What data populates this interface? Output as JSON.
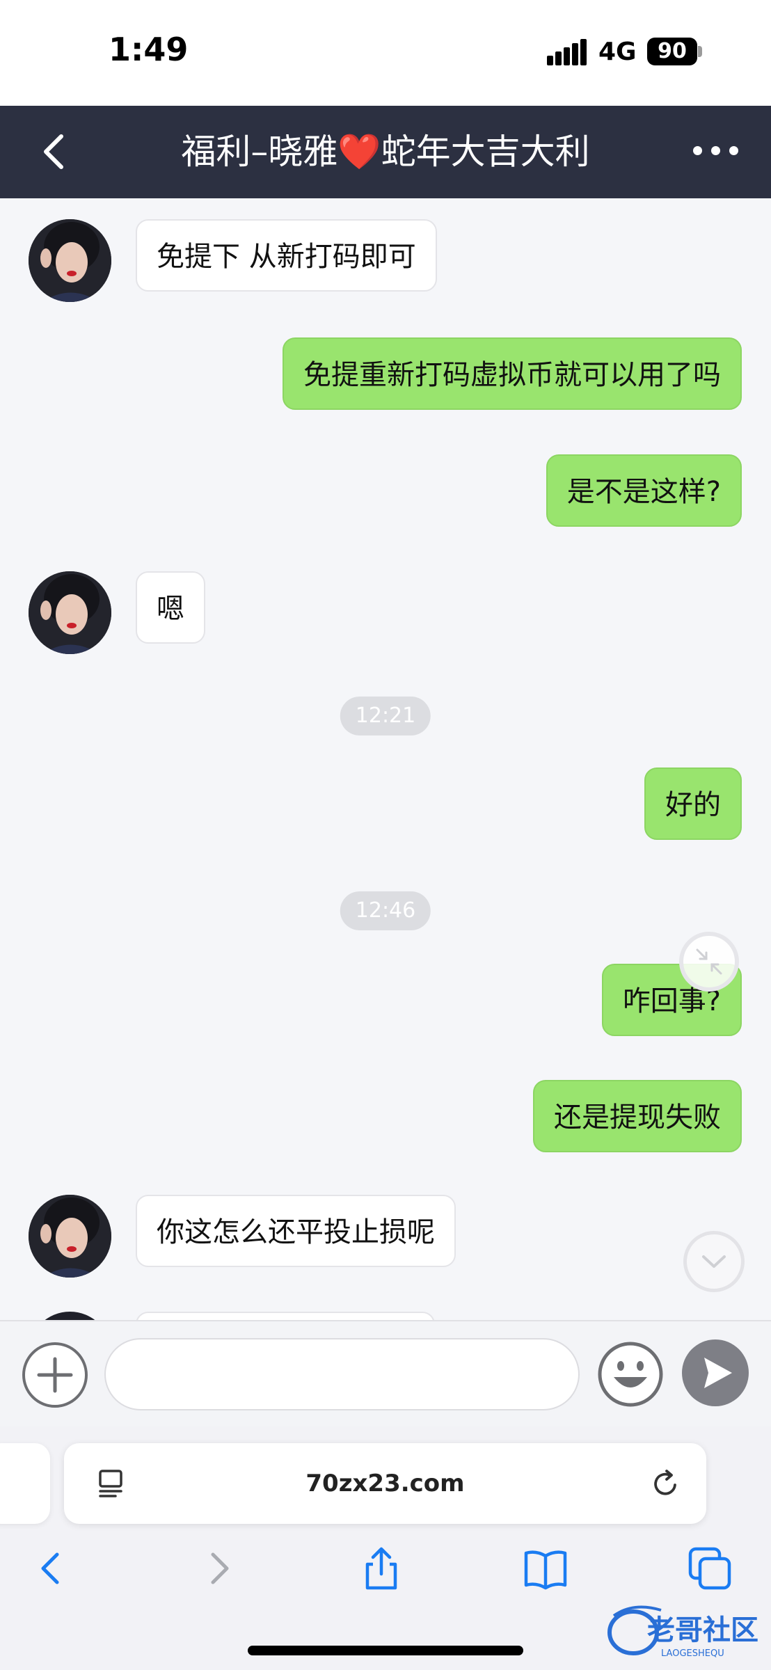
{
  "status_bar": {
    "time": "1:49",
    "network": "4G",
    "battery": "90"
  },
  "header": {
    "title_before": "福利–晓雅",
    "title_heart": "❤️",
    "title_after": "蛇年大吉大利"
  },
  "messages": [
    {
      "side": "in",
      "text": "免提下 从新打码即可"
    },
    {
      "side": "out",
      "text": "免提重新打码虚拟币就可以用了吗"
    },
    {
      "side": "out",
      "text": "是不是这样?"
    },
    {
      "side": "in",
      "text": "嗯"
    },
    {
      "type": "time",
      "text": "12:21"
    },
    {
      "side": "out",
      "text": "好的"
    },
    {
      "type": "time",
      "text": "12:46"
    },
    {
      "side": "out",
      "text": "咋回事?"
    },
    {
      "side": "out",
      "text": "还是提现失败"
    },
    {
      "side": "in",
      "text": "你这怎么还平投止损呢"
    }
  ],
  "composer": {
    "input_value": "",
    "input_placeholder": ""
  },
  "browser": {
    "url": "70zx23.com"
  },
  "watermark": {
    "text": "老哥社区",
    "subtext": "LAOGESHEQU"
  },
  "colors": {
    "header_bg": "#2c3041",
    "chat_bg": "#f5f6f9",
    "outgoing_bubble": "#99e46e",
    "incoming_bubble": "#ffffff",
    "ios_blue": "#1a7cf2"
  },
  "icons": [
    "back-icon",
    "more-icon",
    "shrink-icon",
    "chevron-down-icon",
    "plus-icon",
    "emoji-icon",
    "send-icon",
    "page-menu-icon",
    "reload-icon",
    "back-arrow-icon",
    "forward-arrow-icon",
    "share-icon",
    "bookmarks-icon",
    "tabs-icon"
  ]
}
